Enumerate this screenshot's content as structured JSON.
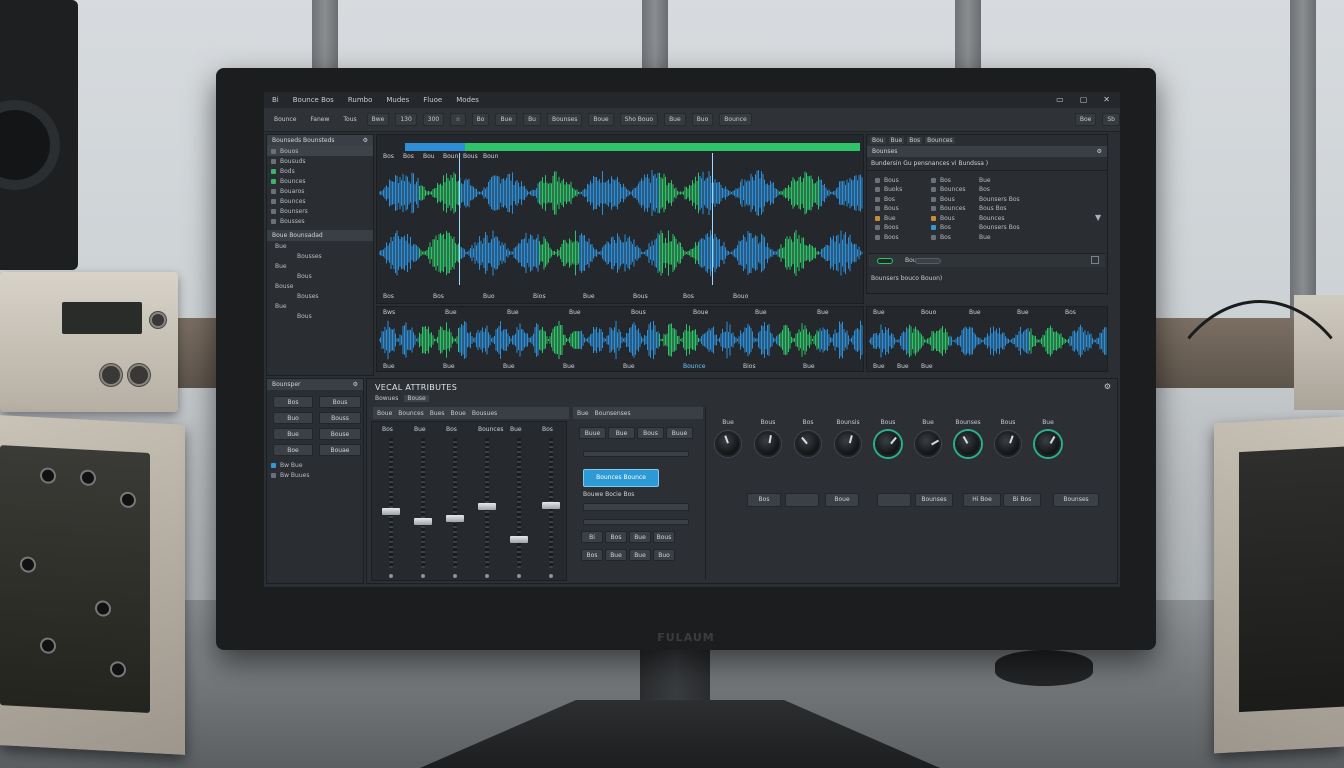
{
  "app": {
    "menu": [
      "Bi",
      "Bounce Bos",
      "Rumbo",
      "Mudes",
      "Fluoe",
      "Modes"
    ],
    "window_controls": [
      "▭",
      "▢",
      "✕"
    ],
    "monitor_brand": "FULAUM"
  },
  "toolbar": {
    "items": [
      "Bounce",
      "Fanew",
      "Tous",
      "Bwe",
      "130",
      "300",
      "☆",
      "Bo",
      "Bue",
      "Bu",
      "Bounses",
      "Boue",
      "Sho Bouo",
      "Bue",
      "Buo",
      "Bounce"
    ],
    "right_items": [
      "Boe",
      "Sb"
    ]
  },
  "left_panel": {
    "header": "Bounseds Bounsteds",
    "tracks": [
      "Bouos",
      "Bousuds",
      "Bods",
      "Bounces",
      "Bouaros",
      "Bounces",
      "Bounsers",
      "Bousses"
    ],
    "sub_header": "Boue Bounsadad",
    "channels": [
      "Bue",
      "Bousses",
      "Bue",
      "Bous",
      "Bouse",
      "Bouses",
      "Bue",
      "Bous"
    ],
    "fx_header": "Bounsper",
    "fx_buttons": [
      "Bos",
      "Buo",
      "Bue",
      "Boe",
      "Bous",
      "Bouss",
      "Bouse",
      "Bouae"
    ],
    "checks": [
      "Bw Bue",
      "Bw Buues"
    ]
  },
  "timeline": {
    "ruler": [
      "Bos",
      "Bos",
      "Bou",
      "Boun",
      "Bous",
      "Boun"
    ],
    "markers": [
      "Bos",
      "Bos",
      "Buo",
      "Bios",
      "Bue",
      "Bous",
      "Bos",
      "Bouo"
    ],
    "lower_markers": [
      "Bws",
      "Bue",
      "Bue",
      "Bue",
      "Bous",
      "Boue",
      "Bue",
      "Bue"
    ],
    "lower_bottom": [
      "Bue",
      "Bue",
      "Bue",
      "Bue",
      "Bue",
      "Bounce",
      "Bios",
      "Bue"
    ]
  },
  "browser": {
    "tabs": [
      "Bou",
      "Bue",
      "Bos",
      "Bounces"
    ],
    "title": "Bounses",
    "path": "Bundersin Gu pensnances vi Bundssa )",
    "col1": [
      "Bous",
      "Buoks",
      "Bos",
      "Bous",
      "Bue",
      "Boos",
      "Boos"
    ],
    "col2": [
      "Bos",
      "Bounces",
      "Bous",
      "Bounces",
      "Bous",
      "Bos",
      "Bos"
    ],
    "col3": [
      "Bue",
      "Bos",
      "Bounsers Bos",
      "Bous Bos",
      "Bounces",
      "Bounsers Bos",
      "Bue"
    ],
    "strip_label": "Bounces",
    "status": "Bounsers bouco Bouon)",
    "mini_markers": [
      "Bue",
      "Bouo",
      "Bue",
      "Bue",
      "Bos"
    ],
    "mini_bottom": [
      "Bue",
      "Bue",
      "Bue"
    ]
  },
  "bottom": {
    "title": "VECAL ATTRIBUTES",
    "tabs": [
      "Bowues",
      "Bouse"
    ],
    "left_tab": "Boue",
    "left_sub": [
      "Bounces",
      "Bues",
      "Boue",
      "Bousues"
    ],
    "mid_tabs": [
      "Bue",
      "Bounsenses"
    ],
    "fader_labels": [
      "Bos",
      "Bue",
      "Bos",
      "Bounces",
      "Bue",
      "Bos"
    ],
    "fader_levels": [
      0.58,
      0.67,
      0.64,
      0.54,
      0.82,
      0.53
    ],
    "mid_grid": [
      "Buue",
      "Bue",
      "Bous",
      "Buue"
    ],
    "highlight_button": "Bounces Bounce",
    "selector": "Bouwe Bocie Bos",
    "small_buttons": [
      "Bi",
      "Bos",
      "Bue",
      "Bous",
      "Bos",
      "Bue",
      "Bue",
      "Buo"
    ],
    "knob_labels": [
      "Bue",
      "Bous",
      "Bos",
      "Bounsis",
      "Bous",
      "Bue",
      "Bounses",
      "Bous",
      "Bue"
    ],
    "knob_angles": [
      -20,
      10,
      -40,
      15,
      40,
      60,
      -30,
      20,
      30
    ],
    "action_buttons": [
      "Bos",
      "",
      "Boue",
      "",
      "Bounses",
      "Hi Boe",
      "Bi Bos",
      "Bounses"
    ]
  },
  "colors": {
    "green": "#2fc46a",
    "blue": "#2e8fd8",
    "accent": "#2d9ad6"
  }
}
